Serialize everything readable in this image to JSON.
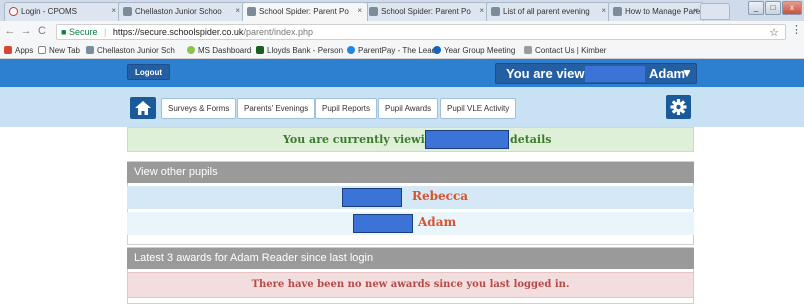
{
  "browser": {
    "tabs": [
      {
        "label": "Login - CPOMS",
        "fav": "#c0392b"
      },
      {
        "label": "Chellaston Junior Schoo",
        "fav": "#5b7c99"
      },
      {
        "label": "School Spider: Parent Po",
        "fav": "#5b7c99"
      },
      {
        "label": "School Spider: Parent Po",
        "fav": "#5b7c99"
      },
      {
        "label": "List of all parent evening",
        "fav": "#5b7c99"
      },
      {
        "label": "How to Manage Parents",
        "fav": "#5b7c99"
      }
    ],
    "tab_close": "×",
    "secure_label": "Secure",
    "url_host": "https://secure.schoolspider.co.uk",
    "url_path": "/parent/index.php",
    "bookmarks": [
      "Apps",
      "New Tab",
      "Chellaston Junior Sch",
      "MS Dashboard",
      "Lloyds Bank - Person",
      "ParentPay - The Lead",
      "Year Group Meeting",
      "Contact Us | Kimber"
    ]
  },
  "header": {
    "logout_label": "Logout",
    "viewing_prefix": "You are viewi",
    "viewing_name": "Adam",
    "caret": "▼"
  },
  "nav": {
    "tabs": [
      "Surveys & Forms",
      "Parents' Evenings",
      "Pupil Reports",
      "Pupil Awards",
      "Pupil VLE Activity"
    ]
  },
  "notice": {
    "prefix": "You are currently viewing",
    "suffix": "details"
  },
  "pupils": {
    "heading": "View other pupils",
    "items": [
      "Rebecca",
      "Adam"
    ]
  },
  "awards": {
    "heading": "Latest 3 awards for Adam Reader since last login",
    "empty_message": "There have been no new awards since you last logged in."
  },
  "colors": {
    "brand_blue": "#2d7fcf",
    "nav_bg": "#c9e2f3",
    "dark_button": "#1a5a9a",
    "pupil_name": "#d9532c",
    "redaction": "#3b74d6"
  }
}
